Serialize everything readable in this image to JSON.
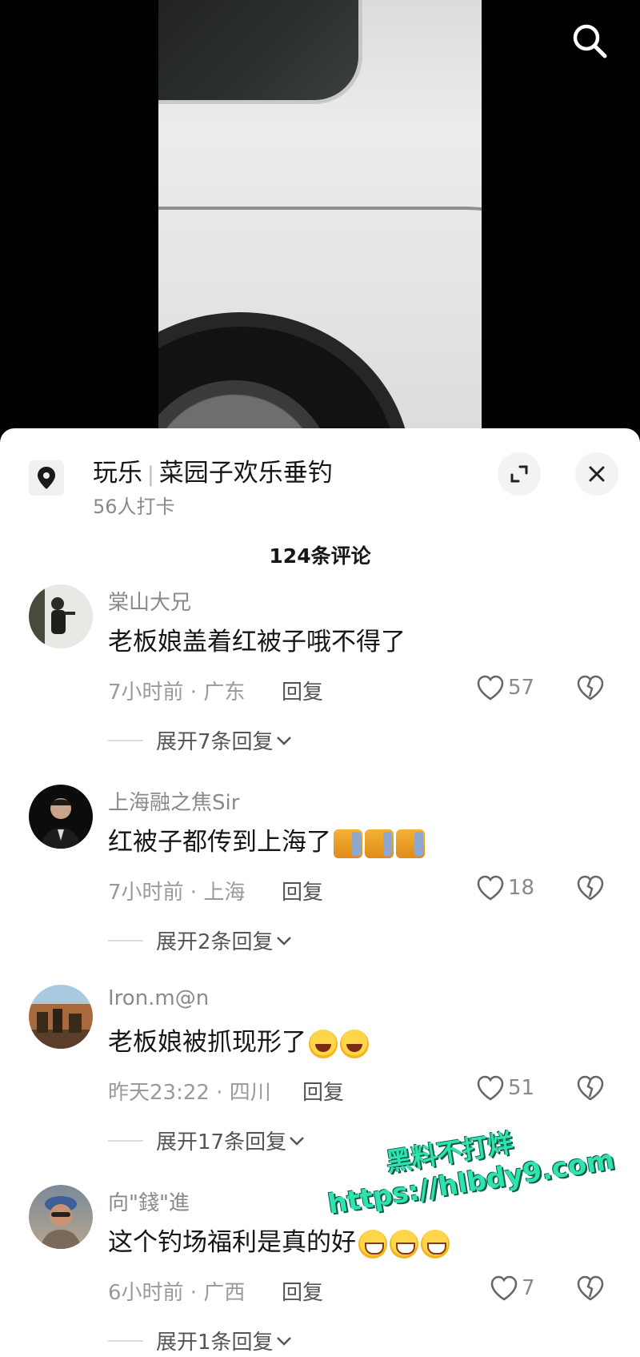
{
  "location": {
    "category": "玩乐",
    "name": "菜园子欢乐垂钓",
    "checkins": "56人打卡"
  },
  "comment_count": "124条评论",
  "comments": [
    {
      "user": "棠山大兄",
      "text": "老板娘盖着红被子哦不得了",
      "time_place": "7小时前 · 广东",
      "reply": "回复",
      "likes": "57",
      "expand": "展开7条回复"
    },
    {
      "user": "上海融之焦Sir",
      "text": "红被子都传到上海了",
      "emoji": [
        "cat-emoji",
        "cat-emoji",
        "cat-emoji"
      ],
      "time_place": "7小时前 · 上海",
      "reply": "回复",
      "likes": "18",
      "expand": "展开2条回复"
    },
    {
      "user": "Iron.m@n",
      "text": "老板娘被抓现形了",
      "emoji": [
        "laughing-emoji",
        "laughing-emoji"
      ],
      "time_place": "昨天23:22 · 四川",
      "reply": "回复",
      "likes": "51",
      "expand": "展开17条回复"
    },
    {
      "user": "向\"錢\"進",
      "text": "这个钓场福利是真的好",
      "emoji": [
        "sweat-smile-emoji",
        "sweat-smile-emoji",
        "sweat-smile-emoji"
      ],
      "time_place": "6小时前 · 广西",
      "reply": "回复",
      "likes": "7",
      "expand": "展开1条回复"
    }
  ],
  "watermark": {
    "line1": "黑料不打烊",
    "line2": "https://hlbdy9.com"
  },
  "colors": {
    "sheet_bg": "#ffffff",
    "secondary_text": "#8a8a8a",
    "watermark": "#2fe3b0"
  }
}
